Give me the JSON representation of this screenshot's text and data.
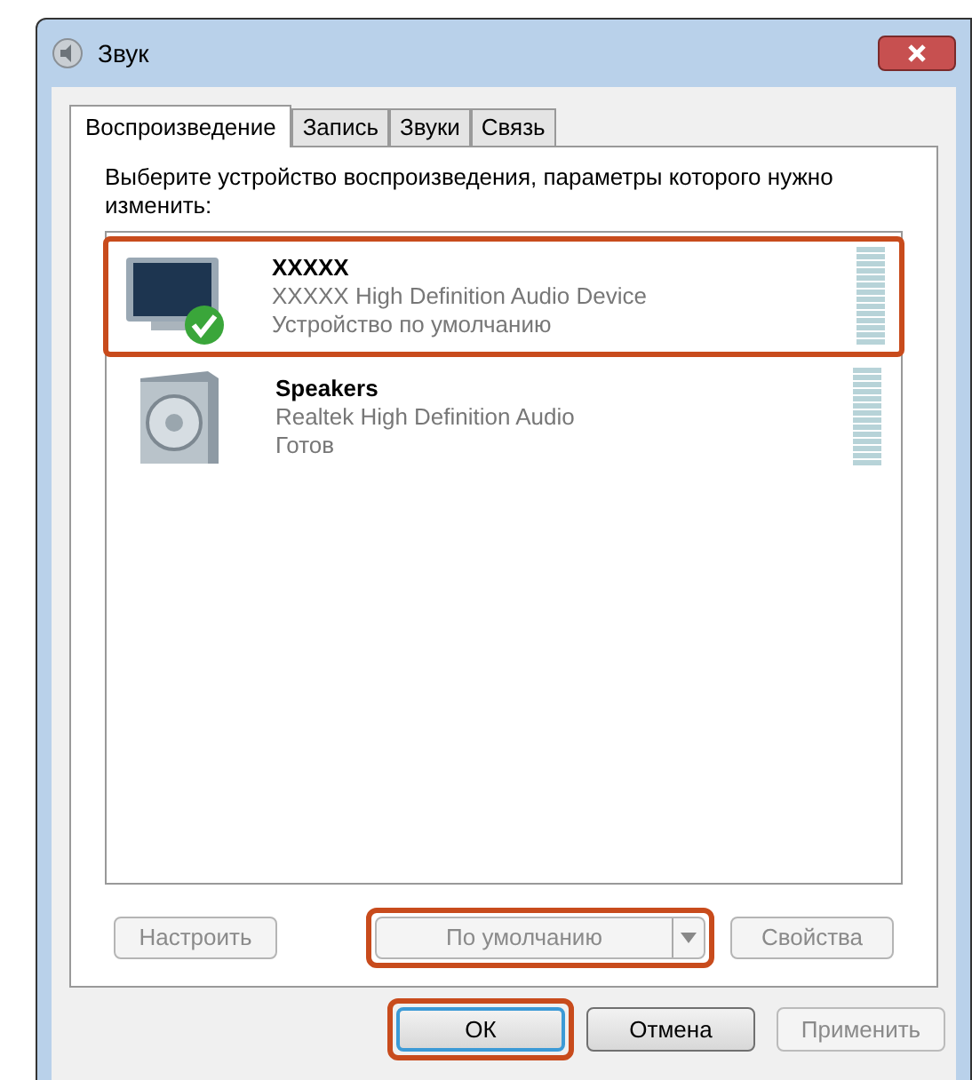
{
  "window": {
    "title": "Звук"
  },
  "tabs": [
    {
      "label": "Воспроизведение",
      "selected": true
    },
    {
      "label": "Запись",
      "selected": false
    },
    {
      "label": "Звуки",
      "selected": false
    },
    {
      "label": "Связь",
      "selected": false
    }
  ],
  "instruction": "Выберите устройство воспроизведения, параметры которого нужно изменить:",
  "devices": [
    {
      "kind": "monitor",
      "name": "XXXXX",
      "description": "XXXXX High Definition Audio Device",
      "status": "Устройство по умолчанию",
      "default": true,
      "highlighted": true
    },
    {
      "kind": "speaker",
      "name": "Speakers",
      "description": "Realtek High Definition Audio",
      "status": "Готов",
      "default": false,
      "highlighted": false
    }
  ],
  "device_buttons": [
    {
      "kind": "plain",
      "label": "Настроить",
      "disabled": true,
      "highlighted": false
    },
    {
      "kind": "split",
      "label": "По умолчанию",
      "disabled": true,
      "highlighted": true
    },
    {
      "kind": "plain",
      "label": "Свойства",
      "disabled": true,
      "highlighted": false
    }
  ],
  "dialog_buttons": [
    {
      "label": "ОК",
      "disabled": false,
      "default": true,
      "highlighted": true
    },
    {
      "label": "Отмена",
      "disabled": false,
      "default": false,
      "highlighted": false
    },
    {
      "label": "Применить",
      "disabled": true,
      "default": false,
      "highlighted": false
    }
  ]
}
